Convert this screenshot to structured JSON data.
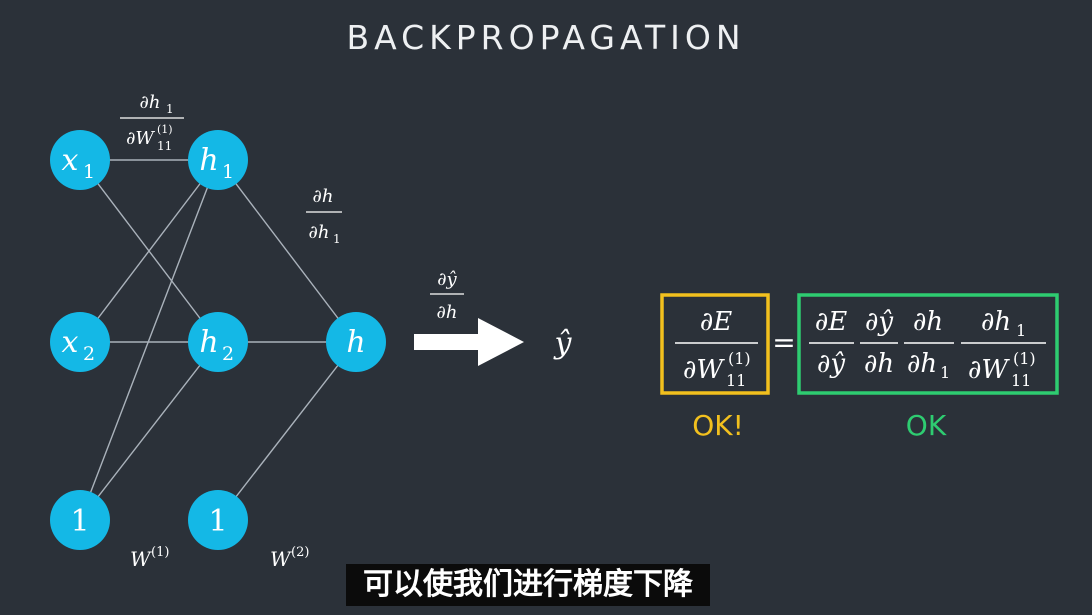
{
  "title": "BACKPROPAGATION",
  "nodes": {
    "x1": {
      "base": "x",
      "sub": "1"
    },
    "x2": {
      "base": "x",
      "sub": "2"
    },
    "h1": {
      "base": "h",
      "sub": "1"
    },
    "h2": {
      "base": "h",
      "sub": "2"
    },
    "h": {
      "base": "h",
      "sub": ""
    },
    "bias1": {
      "base": "1",
      "sub": ""
    },
    "bias2": {
      "base": "1",
      "sub": ""
    }
  },
  "edge_labels": {
    "dh1_dW11": {
      "num": "∂h",
      "num_sub": "1",
      "den": "∂W",
      "den_sub": "11",
      "den_sup": "(1)"
    },
    "dh_dh1": {
      "num": "∂h",
      "num_sub": "",
      "den": "∂h",
      "den_sub": "1"
    },
    "dyhat_dh": {
      "num": "∂ŷ",
      "den": "∂h"
    }
  },
  "weight_labels": {
    "w1": {
      "base": "W",
      "sup": "(1)"
    },
    "w2": {
      "base": "W",
      "sup": "(2)"
    }
  },
  "output": {
    "symbol": "ŷ"
  },
  "equation": {
    "lhs": {
      "num": "∂E",
      "den": "∂W",
      "den_sub": "11",
      "den_sup": "(1)"
    },
    "equals": "=",
    "rhs": [
      {
        "num": "∂E",
        "den": "∂ŷ"
      },
      {
        "num": "∂ŷ",
        "den": "∂h"
      },
      {
        "num": "∂h",
        "den": "∂h",
        "den_sub": "1"
      },
      {
        "num": "∂h",
        "num_sub": "1",
        "den": "∂W",
        "den_sub": "11",
        "den_sup": "(1)"
      }
    ]
  },
  "labels": {
    "lhs_status": "OK!",
    "rhs_status": "OK"
  },
  "subtitle": "可以使我们进行梯度下降",
  "colors": {
    "background": "#2b3139",
    "node": "#14b8e6",
    "edge": "#aab2bb",
    "yellow": "#f2c01e",
    "green": "#2ecc71",
    "text": "#ffffff"
  }
}
